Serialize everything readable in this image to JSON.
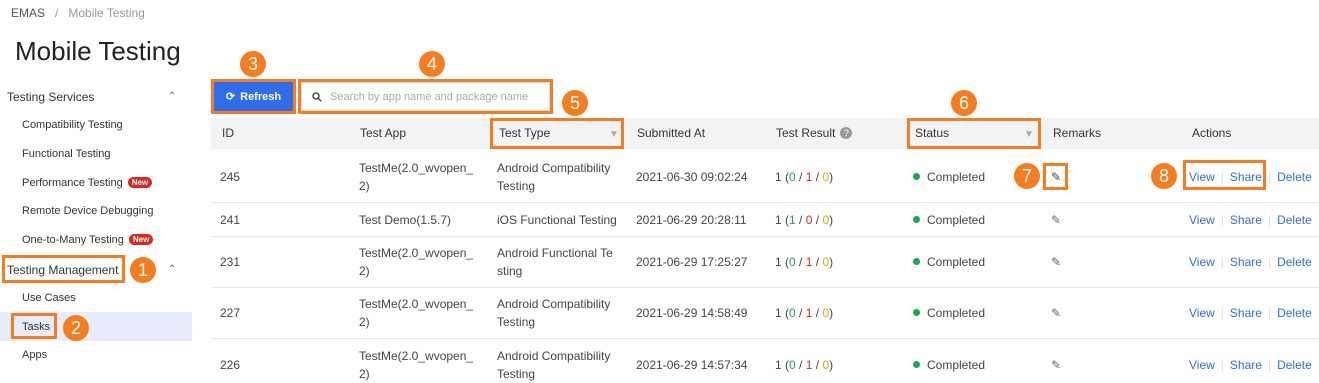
{
  "breadcrumb": {
    "root": "EMAS",
    "separator": "/",
    "current": "Mobile Testing"
  },
  "page_title": "Mobile Testing",
  "sidebar": {
    "group1": {
      "label": "Testing Services",
      "caret": "^"
    },
    "services": [
      {
        "label": "Compatibility Testing",
        "badge": ""
      },
      {
        "label": "Functional Testing",
        "badge": ""
      },
      {
        "label": "Performance Testing",
        "badge": "New"
      },
      {
        "label": "Remote Device Debugging",
        "badge": ""
      },
      {
        "label": "One-to-Many Testing",
        "badge": "New"
      }
    ],
    "group2": {
      "label": "Testing Management",
      "caret": "^"
    },
    "management": [
      {
        "label": "Use Cases"
      },
      {
        "label": "Tasks"
      },
      {
        "label": "Apps"
      }
    ]
  },
  "toolbar": {
    "refresh_label": "Refresh",
    "search_placeholder": "Search by app name and package name"
  },
  "table": {
    "headers": {
      "id": "ID",
      "app": "Test App",
      "type": "Test Type",
      "submitted": "Submitted At",
      "result": "Test Result",
      "status": "Status",
      "remarks": "Remarks",
      "actions": "Actions"
    },
    "rows": [
      {
        "id": "245",
        "app1": "TestMe(2.0_wvopen_",
        "app2": "2)",
        "type1": "Android Compatibility",
        "type2": "Testing",
        "submitted": "2021-06-30 09:02:24",
        "r_total": "1",
        "r_pass": "0",
        "r_fail": "1",
        "r_warn": "0",
        "status": "Completed"
      },
      {
        "id": "241",
        "app1": "Test Demo(1.5.7)",
        "app2": "",
        "type1": "iOS Functional Testing",
        "type2": "",
        "submitted": "2021-06-29 20:28:11",
        "r_total": "1",
        "r_pass": "1",
        "r_fail": "0",
        "r_warn": "0",
        "status": "Completed"
      },
      {
        "id": "231",
        "app1": "TestMe(2.0_wvopen_",
        "app2": "2)",
        "type1": "Android Functional Te",
        "type2": "sting",
        "submitted": "2021-06-29 17:25:27",
        "r_total": "1",
        "r_pass": "0",
        "r_fail": "1",
        "r_warn": "0",
        "status": "Completed"
      },
      {
        "id": "227",
        "app1": "TestMe(2.0_wvopen_",
        "app2": "2)",
        "type1": "Android Compatibility",
        "type2": "Testing",
        "submitted": "2021-06-29 14:58:49",
        "r_total": "1",
        "r_pass": "0",
        "r_fail": "1",
        "r_warn": "0",
        "status": "Completed"
      },
      {
        "id": "226",
        "app1": "TestMe(2.0_wvopen_",
        "app2": "2)",
        "type1": "Android Compatibility",
        "type2": "Testing",
        "submitted": "2021-06-29 14:57:34",
        "r_total": "1",
        "r_pass": "0",
        "r_fail": "1",
        "r_warn": "0",
        "status": "Completed"
      }
    ],
    "actions": {
      "view": "View",
      "share": "Share",
      "delete": "Delete"
    }
  },
  "annotations": [
    "1",
    "2",
    "3",
    "4",
    "5",
    "6",
    "7",
    "8"
  ],
  "colors": {
    "accent": "#2f6ded",
    "annotation": "#f57c1f",
    "success": "#1ea64a",
    "fail": "#e0261b",
    "warn": "#e3a400"
  }
}
